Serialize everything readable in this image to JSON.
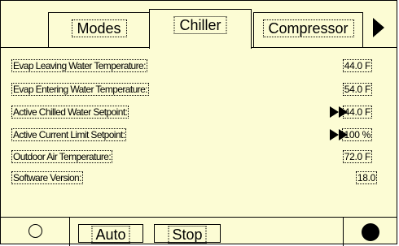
{
  "tabs": [
    {
      "label": "Modes",
      "active": false
    },
    {
      "label": "Chiller",
      "active": true
    },
    {
      "label": "Compressor",
      "active": false
    }
  ],
  "rows": [
    {
      "label": "Evap Leaving Water Temperature:",
      "value": "44.0 F",
      "has_arrow": false
    },
    {
      "label": "Evap Entering Water Temperature:",
      "value": "54.0 F",
      "has_arrow": false
    },
    {
      "label": "Active Chilled Water Setpoint:",
      "value": "44.0 F",
      "has_arrow": true
    },
    {
      "label": "Active Current Limit Setpoint:",
      "value": "100 %",
      "has_arrow": true
    },
    {
      "label": "Outdoor Air Temperature:",
      "value": "72.0 F",
      "has_arrow": false
    },
    {
      "label": "Software Version:",
      "value": "18.0",
      "has_arrow": false
    }
  ],
  "bottom": {
    "auto_label": "Auto",
    "stop_label": "Stop"
  },
  "icons": {
    "next_tab": "triangle-right-icon",
    "setpoint_arrow": "double-arrow-right-icon",
    "status_left": "circle-outline-icon",
    "status_right": "circle-filled-icon"
  },
  "colors": {
    "panel_background": "#fcfcd4",
    "foreground": "#000000"
  }
}
